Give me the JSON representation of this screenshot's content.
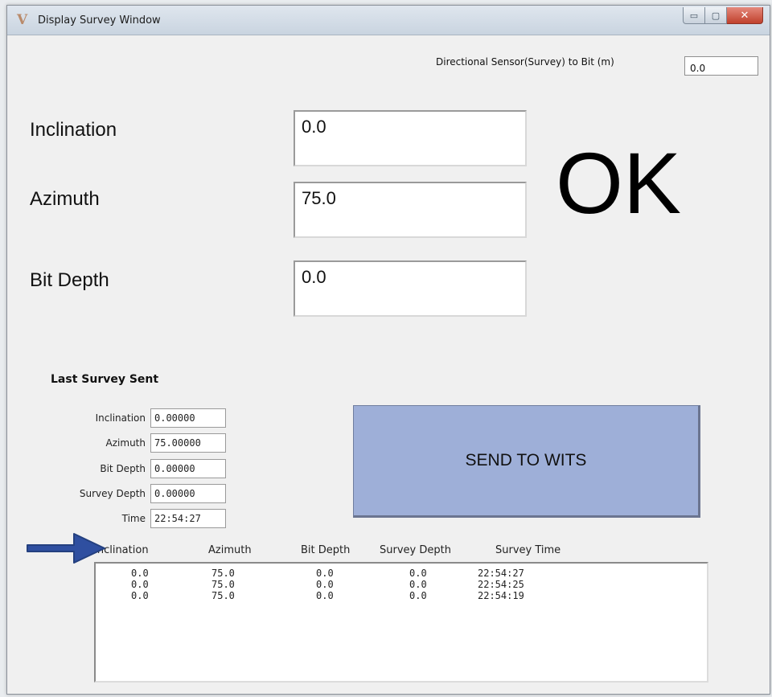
{
  "window": {
    "title": "Display Survey Window",
    "app_icon_glyph": "V",
    "min_glyph": "▭",
    "max_glyph": "▢",
    "close_glyph": "✕"
  },
  "sensor": {
    "label": "Directional Sensor(Survey) to Bit (m)",
    "value": "0.0"
  },
  "main": {
    "inclination_label": "Inclination",
    "inclination_value": "0.0",
    "azimuth_label": "Azimuth",
    "azimuth_value": "75.0",
    "bit_depth_label": "Bit Depth",
    "bit_depth_value": "0.0",
    "status": "OK"
  },
  "last_survey": {
    "title": "Last Survey Sent",
    "fields": [
      {
        "label": "Inclination",
        "value": "0.00000"
      },
      {
        "label": "Azimuth",
        "value": "75.00000"
      },
      {
        "label": "Bit Depth",
        "value": "0.00000"
      },
      {
        "label": "Survey Depth",
        "value": "0.00000"
      },
      {
        "label": "Time",
        "value": "22:54:27"
      }
    ]
  },
  "send_button": {
    "label": "SEND TO WITS"
  },
  "table": {
    "columns": [
      "Inclination",
      "Azimuth",
      "Bit Depth",
      "Survey Depth",
      "Survey Time"
    ],
    "rows": [
      [
        "0.0",
        "75.0",
        "0.0",
        "0.0",
        "22:54:27"
      ],
      [
        "0.0",
        "75.0",
        "0.0",
        "0.0",
        "22:54:25"
      ],
      [
        "0.0",
        "75.0",
        "0.0",
        "0.0",
        "22:54:19"
      ]
    ]
  },
  "colors": {
    "send_button": "#9eafd8",
    "arrow": "#2f4fa0"
  },
  "icons": {
    "pointer": "right-arrow-icon"
  }
}
